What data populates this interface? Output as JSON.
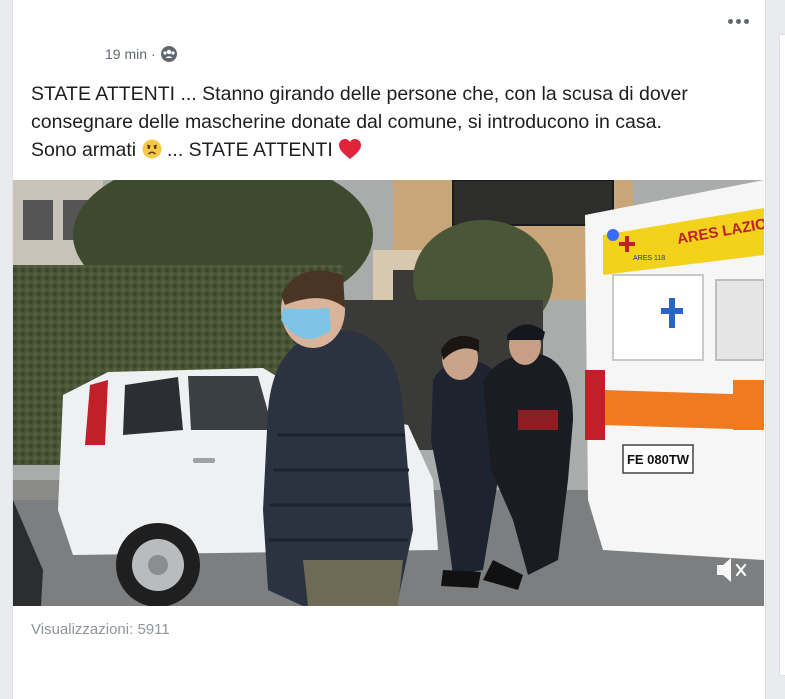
{
  "post": {
    "timestamp": "19 min",
    "separator": "·",
    "privacy_icon": "group-icon",
    "text_line1": "STATE ATTENTI ... Stanno girando delle persone che, con la scusa di dover",
    "text_line2": "consegnare delle mascherine donate dal comune, si introducono in casa.",
    "text_line3a": "Sono armati",
    "text_line3b": "... STATE ATTENTI",
    "emoji1": "frowning-face-emoji",
    "emoji2": "red-heart-emoji",
    "menu_icon": "more-options-icon"
  },
  "video": {
    "ambulance_text": "ARES LAZIO",
    "ambulance_small": "ARES 118",
    "license_plate": "FE 080TW",
    "mute_icon": "speaker-muted-icon"
  },
  "footer": {
    "views": "Visualizzazioni: 5911"
  },
  "colors": {
    "text": "#1c1e21",
    "secondary": "#606770",
    "muted": "#90949c",
    "heart": "#e0243a",
    "ambulance_orange": "#f07a1f",
    "ambulance_yellow": "#f2d21a"
  }
}
